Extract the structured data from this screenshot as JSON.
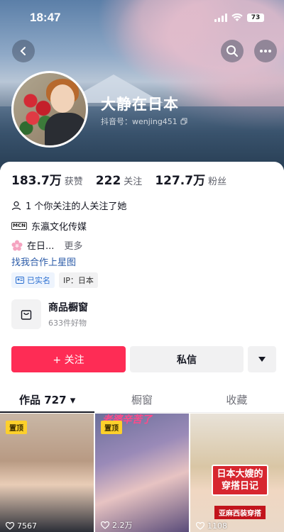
{
  "status_bar": {
    "time": "18:47",
    "battery": "73"
  },
  "profile": {
    "name": "大静在日本",
    "handle": "抖音号：wenjing451"
  },
  "stats": [
    {
      "value": "183.7万",
      "label": "获赞"
    },
    {
      "value": "222",
      "label": "关注"
    },
    {
      "value": "127.7万",
      "label": "粉丝"
    }
  ],
  "info": {
    "mutual": "1 个你关注的人关注了她",
    "mcn_badge": "MCN",
    "company": "东瀛文化传媒",
    "bio": "在日...",
    "more": "更多",
    "cooperate_link": "找我合作上星图"
  },
  "tags": {
    "verified": "已实名",
    "ip": "IP：日本"
  },
  "shop": {
    "title": "商品橱窗",
    "subtitle": "633件好物"
  },
  "actions": {
    "follow": "+ 关注",
    "message": "私信",
    "more": "▼"
  },
  "tabs": [
    {
      "label": "作品 727 ▾",
      "active": true
    },
    {
      "label": "橱窗",
      "active": false
    },
    {
      "label": "收藏",
      "active": false
    }
  ],
  "videos": [
    {
      "pinned_label": "置顶",
      "likes": "7567"
    },
    {
      "pinned_label": "置顶",
      "likes": "2.2万",
      "overlay_title": "老婆辛苦了"
    },
    {
      "likes": "1108",
      "caption": "日本大嫂的穿搭日记",
      "sub_caption": "亚麻西装穿搭"
    }
  ],
  "colors": {
    "accent": "#fe2c55",
    "link": "#2b5ba8",
    "pin": "#fdd02b"
  }
}
